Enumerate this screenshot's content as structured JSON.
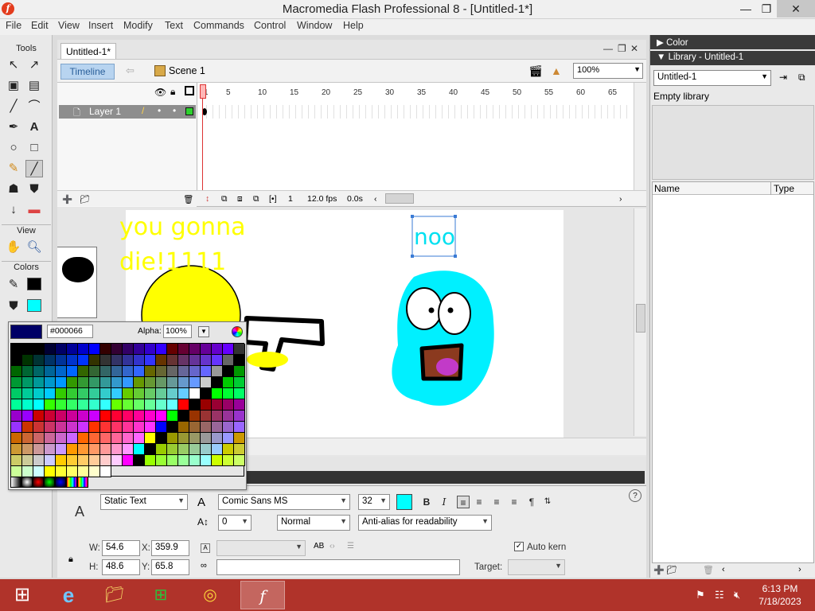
{
  "window": {
    "title": "Macromedia Flash Professional 8 - [Untitled-1*]",
    "buttons": [
      "—",
      "❐",
      "✕"
    ]
  },
  "menu": [
    "File",
    "Edit",
    "View",
    "Insert",
    "Modify",
    "Text",
    "Commands",
    "Control",
    "Window",
    "Help"
  ],
  "tools": {
    "title": "Tools",
    "view_label": "View",
    "colors_label": "Colors"
  },
  "document": {
    "tab": "Untitled-1*",
    "timeline_button": "Timeline",
    "scene": "Scene 1",
    "zoom": "100%"
  },
  "timeline": {
    "layer_name": "Layer 1",
    "ruler": [
      "1",
      "5",
      "10",
      "15",
      "20",
      "25",
      "30",
      "35",
      "40",
      "45",
      "50",
      "55",
      "60",
      "65"
    ],
    "current_frame": "1",
    "fps": "12.0 fps",
    "elapsed": "0.0s"
  },
  "stage": {
    "text_1": "you gonna",
    "text_2": "die!1111",
    "selected_text": "noo"
  },
  "swatches": {
    "hex": "#000066",
    "alpha_label": "Alpha:",
    "alpha": "100%",
    "preview_color": "#000066"
  },
  "properties": {
    "text_type": "Static Text",
    "font": "Comic Sans MS",
    "size": "32",
    "letter_spacing": "0",
    "position_mode": "Normal",
    "anti_alias": "Anti-alias for readability",
    "auto_kern": "Auto kern",
    "w_label": "W:",
    "w": "54.6",
    "h_label": "H:",
    "h": "48.6",
    "x_label": "X:",
    "x": "359.9",
    "y_label": "Y:",
    "y": "65.8",
    "target_label": "Target:",
    "text_color": "#00ffff",
    "bold": "B",
    "italic": "I"
  },
  "right_panel": {
    "color_header": "Color",
    "library_header": "Library - Untitled-1",
    "library_select": "Untitled-1",
    "empty_label": "Empty library",
    "col_name": "Name",
    "col_type": "Type"
  },
  "taskbar": {
    "time": "6:13 PM",
    "date": "7/18/2023"
  },
  "colors": {
    "taskbar": "#b0332a",
    "stage_text_yellow": "#ffff00",
    "ghost_cyan": "#00f0ff"
  }
}
